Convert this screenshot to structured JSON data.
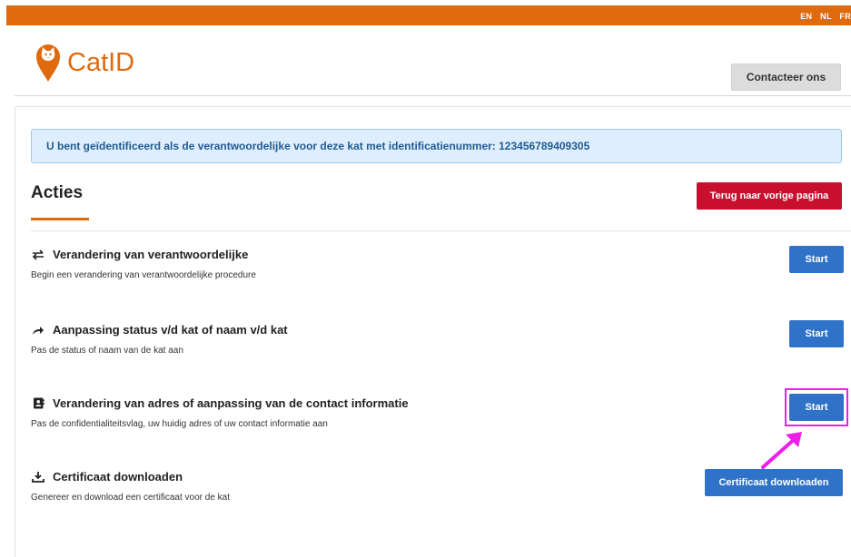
{
  "header": {
    "languages": [
      "EN",
      "NL",
      "FR"
    ],
    "logo_text": "CatID",
    "contact_button": "Contacteer ons"
  },
  "alert": {
    "text": "U bent geïdentificeerd als de verantwoordelijke voor deze kat met identificatienummer: 123456789409305"
  },
  "acties": {
    "title": "Acties",
    "back_button": "Terug naar vorige pagina"
  },
  "actions": [
    {
      "icon": "swap-arrows-icon",
      "title": "Verandering van verantwoordelijke",
      "description": "Begin een verandering van verantwoordelijke procedure",
      "button": "Start"
    },
    {
      "icon": "share-arrow-icon",
      "title": "Aanpassing status v/d kat of naam v/d kat",
      "description": "Pas de status of naam van de kat aan",
      "button": "Start"
    },
    {
      "icon": "address-book-icon",
      "title": "Verandering van adres of aanpassing van de contact informatie",
      "description": "Pas de confidentialiteitsvlag, uw huidig adres of uw contact informatie aan",
      "button": "Start"
    },
    {
      "icon": "download-icon",
      "title": "Certificaat downloaden",
      "description": "Genereer en download een certificaat voor de kat",
      "button": "Certificaat downloaden"
    }
  ],
  "colors": {
    "brand": "#e06a0e",
    "primary_button": "#2f73c9",
    "danger_button": "#c8102e",
    "alert_bg": "#dfeefc",
    "annotation": "#ee1eea"
  }
}
